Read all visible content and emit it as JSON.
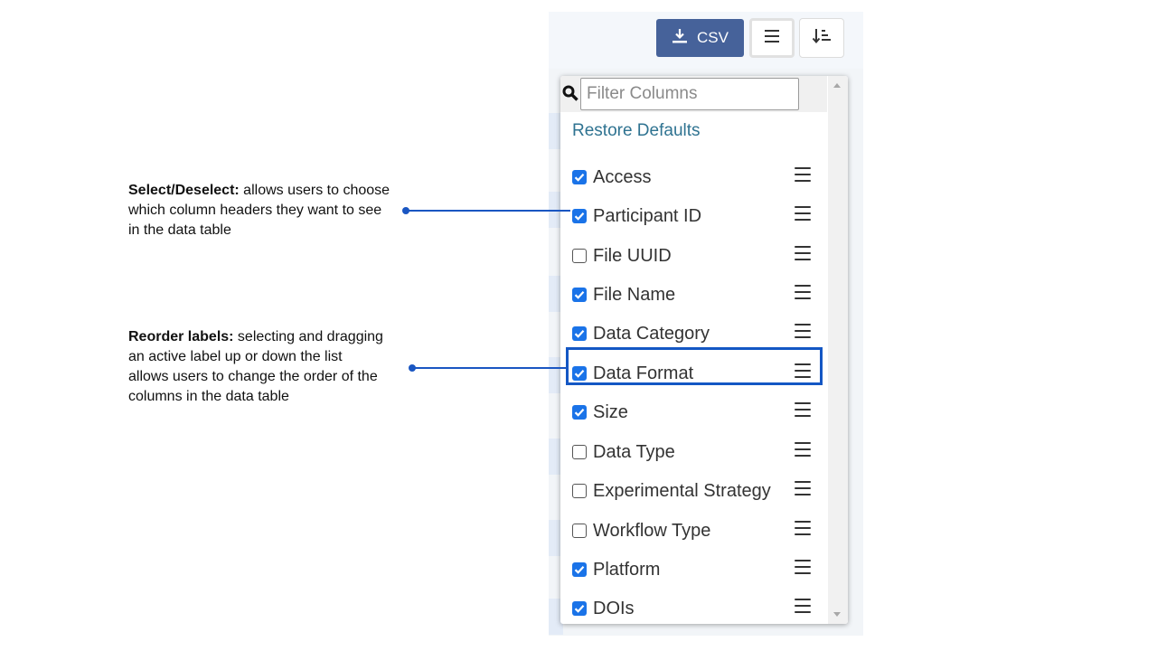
{
  "toolbar": {
    "csv_label": "CSV",
    "csv_icon": "download-icon",
    "menu_icon": "hamburger-icon",
    "sort_icon": "sort-icon"
  },
  "column_menu": {
    "filter_placeholder": "Filter Columns",
    "filter_value": "",
    "restore_label": "Restore Defaults",
    "items": [
      {
        "label": "Access",
        "checked": true
      },
      {
        "label": "Participant ID",
        "checked": true
      },
      {
        "label": "File UUID",
        "checked": false
      },
      {
        "label": "File Name",
        "checked": true
      },
      {
        "label": "Data Category",
        "checked": true
      },
      {
        "label": "Data Format",
        "checked": true
      },
      {
        "label": "Size",
        "checked": true
      },
      {
        "label": "Data Type",
        "checked": false
      },
      {
        "label": "Experimental Strategy",
        "checked": false
      },
      {
        "label": "Workflow Type",
        "checked": false
      },
      {
        "label": "Platform",
        "checked": true
      },
      {
        "label": "DOIs",
        "checked": true
      }
    ]
  },
  "annotations": {
    "select": {
      "title": "Select/Deselect:",
      "line1": " allows users to choose",
      "line2": "which column headers they want to see",
      "line3": "in the data table"
    },
    "reorder": {
      "title": "Reorder labels:",
      "line1": " selecting and dragging",
      "line2": "an active label up or down the list",
      "line3": "allows users to change the order of the",
      "line4": "columns in the data table"
    }
  },
  "colors": {
    "accent": "#1a56c2",
    "csv_button": "#46629a",
    "checkbox": "#1a73e8",
    "restore_link": "#2f7391"
  }
}
